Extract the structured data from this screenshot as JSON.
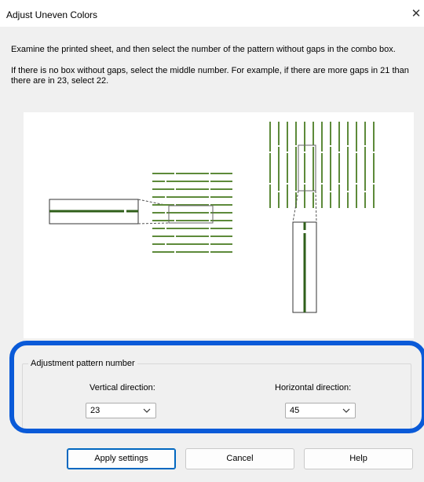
{
  "window": {
    "title": "Adjust Uneven Colors",
    "close_glyph": "✕"
  },
  "instructions": {
    "line1": "Examine the printed sheet, and then select the number of the pattern without gaps in the combo box.",
    "line2": "If there is no box without gaps, select the middle number. For example, if there are more gaps in 21 than there are in 23, select 22."
  },
  "group": {
    "legend": "Adjustment pattern number",
    "vertical": {
      "label": "Vertical direction:",
      "value": "23"
    },
    "horizontal": {
      "label": "Horizontal direction:",
      "value": "45"
    }
  },
  "buttons": {
    "apply": "Apply settings",
    "cancel": "Cancel",
    "help": "Help"
  },
  "colors": {
    "highlight": "#0a5ad8",
    "pattern_line": "#4a7a2a",
    "default_button_border": "#0067c0"
  }
}
